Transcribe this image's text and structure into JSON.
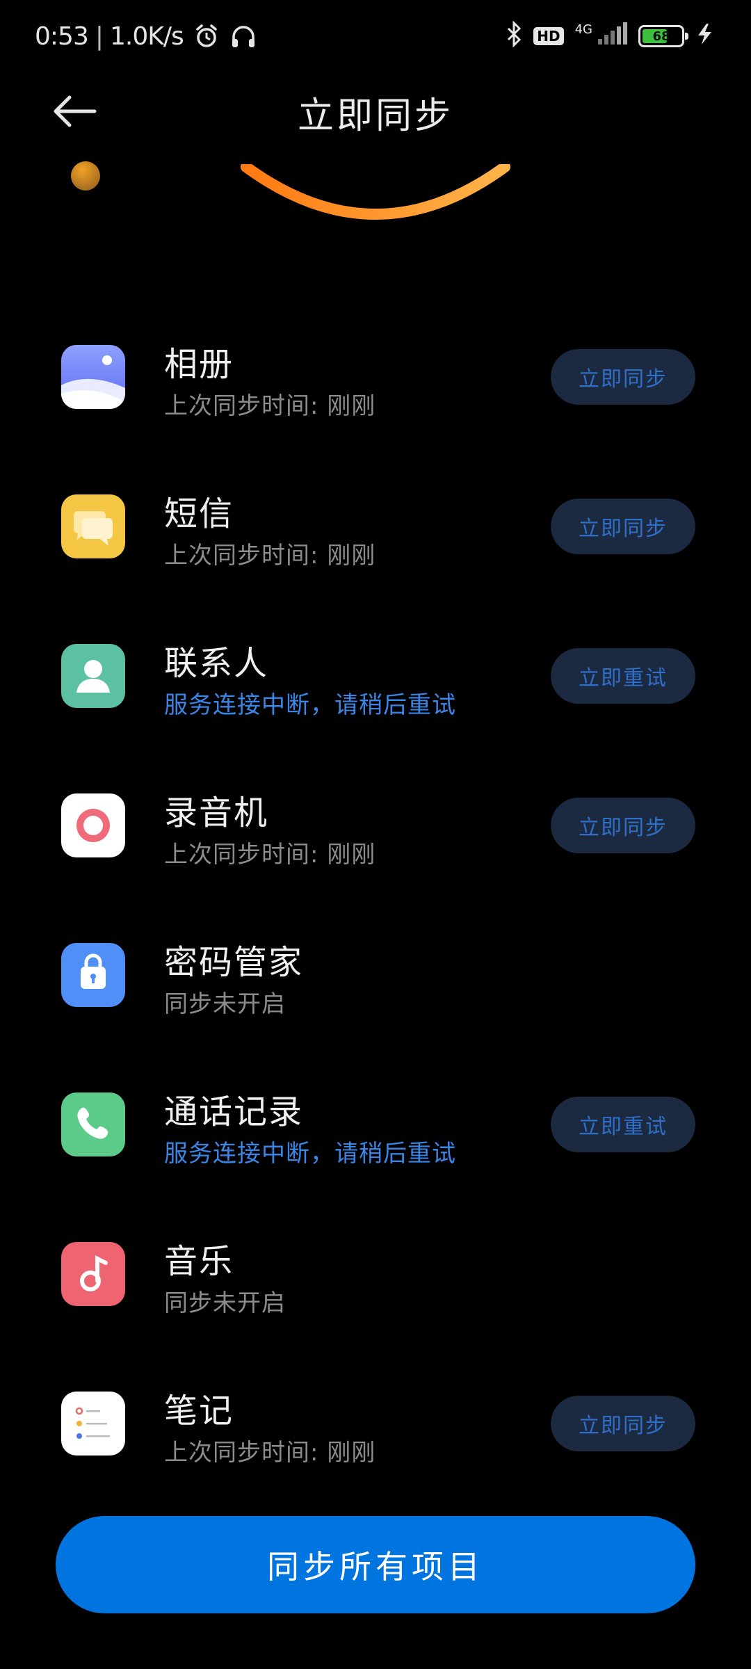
{
  "status_bar": {
    "time": "0:53",
    "speed": "1.0K/s",
    "hd": "HD",
    "network": "4G",
    "battery": "68",
    "battery_level": 0.68
  },
  "header": {
    "title": "立即同步"
  },
  "colors": {
    "accent": "#0075e0",
    "button_bg": "#1b2a40",
    "button_text": "#2f6fca",
    "error_text": "#3a86e6"
  },
  "items": [
    {
      "name": "相册",
      "status": "上次同步时间: 刚刚",
      "status_type": "normal",
      "button": "立即同步",
      "icon": "gallery-icon"
    },
    {
      "name": "短信",
      "status": "上次同步时间: 刚刚",
      "status_type": "normal",
      "button": "立即同步",
      "icon": "messages-icon"
    },
    {
      "name": "联系人",
      "status": "服务连接中断，请稍后重试",
      "status_type": "error",
      "button": "立即重试",
      "icon": "contacts-icon"
    },
    {
      "name": "录音机",
      "status": "上次同步时间: 刚刚",
      "status_type": "normal",
      "button": "立即同步",
      "icon": "recorder-icon"
    },
    {
      "name": "密码管家",
      "status": "同步未开启",
      "status_type": "normal",
      "button": null,
      "icon": "password-manager-icon"
    },
    {
      "name": "通话记录",
      "status": "服务连接中断，请稍后重试",
      "status_type": "error",
      "button": "立即重试",
      "icon": "phone-icon"
    },
    {
      "name": "音乐",
      "status": "同步未开启",
      "status_type": "normal",
      "button": null,
      "icon": "music-icon"
    },
    {
      "name": "笔记",
      "status": "上次同步时间: 刚刚",
      "status_type": "normal",
      "button": "立即同步",
      "icon": "notes-icon"
    }
  ],
  "sync_all_label": "同步所有项目"
}
